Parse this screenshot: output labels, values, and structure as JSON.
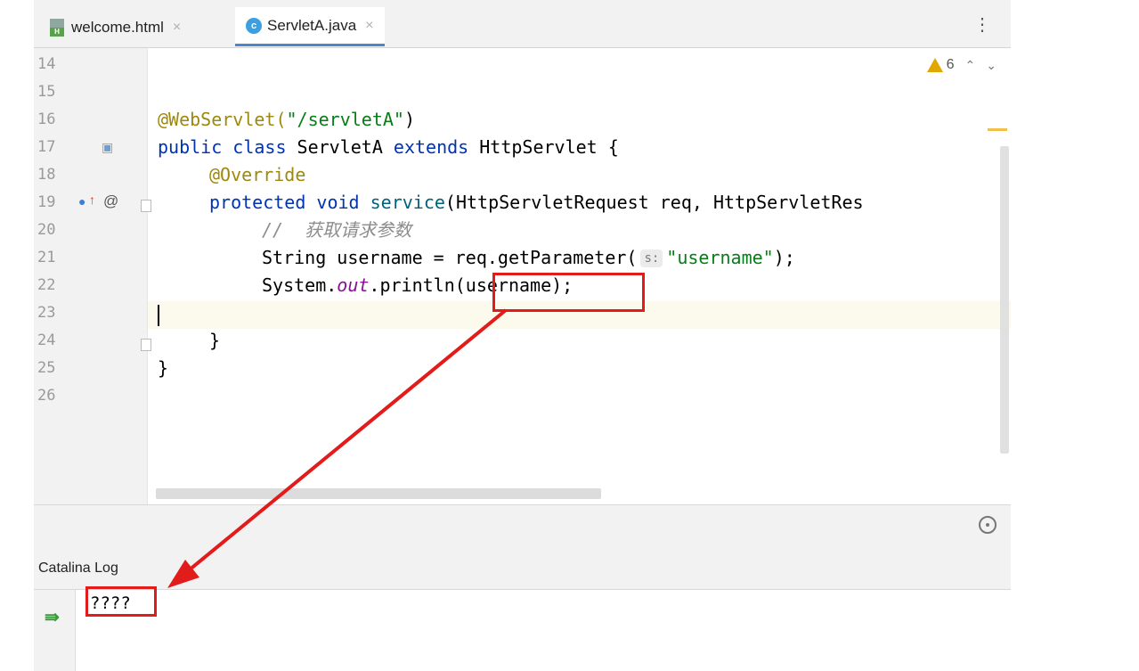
{
  "tabs": [
    {
      "label": "welcome.html",
      "active": false,
      "icon": "html-file-icon"
    },
    {
      "label": "ServletA.java",
      "active": true,
      "icon": "java-class-icon"
    }
  ],
  "editor": {
    "warning_count": "6",
    "param_hint": "s:",
    "line_numbers": [
      "14",
      "15",
      "16",
      "17",
      "18",
      "19",
      "20",
      "21",
      "22",
      "23",
      "24",
      "25",
      "26"
    ],
    "code": {
      "l16_ann": "@WebServlet(",
      "l16_str": "\"/servletA\"",
      "l16_end": ")",
      "l17_kw1": "public class",
      "l17_mid": " ServletA ",
      "l17_kw2": "extends",
      "l17_end": " HttpServlet {",
      "l18": "@Override",
      "l19_kw": "protected void",
      "l19_method": "service",
      "l19_end": "(HttpServletRequest req, HttpServletRes",
      "l20": "//  获取请求参数",
      "l21_start": "String username = req.getParameter(",
      "l21_str": "\"username\"",
      "l21_end": ");",
      "l22_start": "System.",
      "l22_field": "out",
      "l22_end": ".println(username);",
      "l24": "}",
      "l25": "}"
    }
  },
  "log": {
    "title": "Catalina Log",
    "output": "????"
  },
  "colors": {
    "annotation_red": "#e21b1b",
    "keyword": "#0033b3",
    "string": "#067d17",
    "annotation": "#9e880d"
  }
}
